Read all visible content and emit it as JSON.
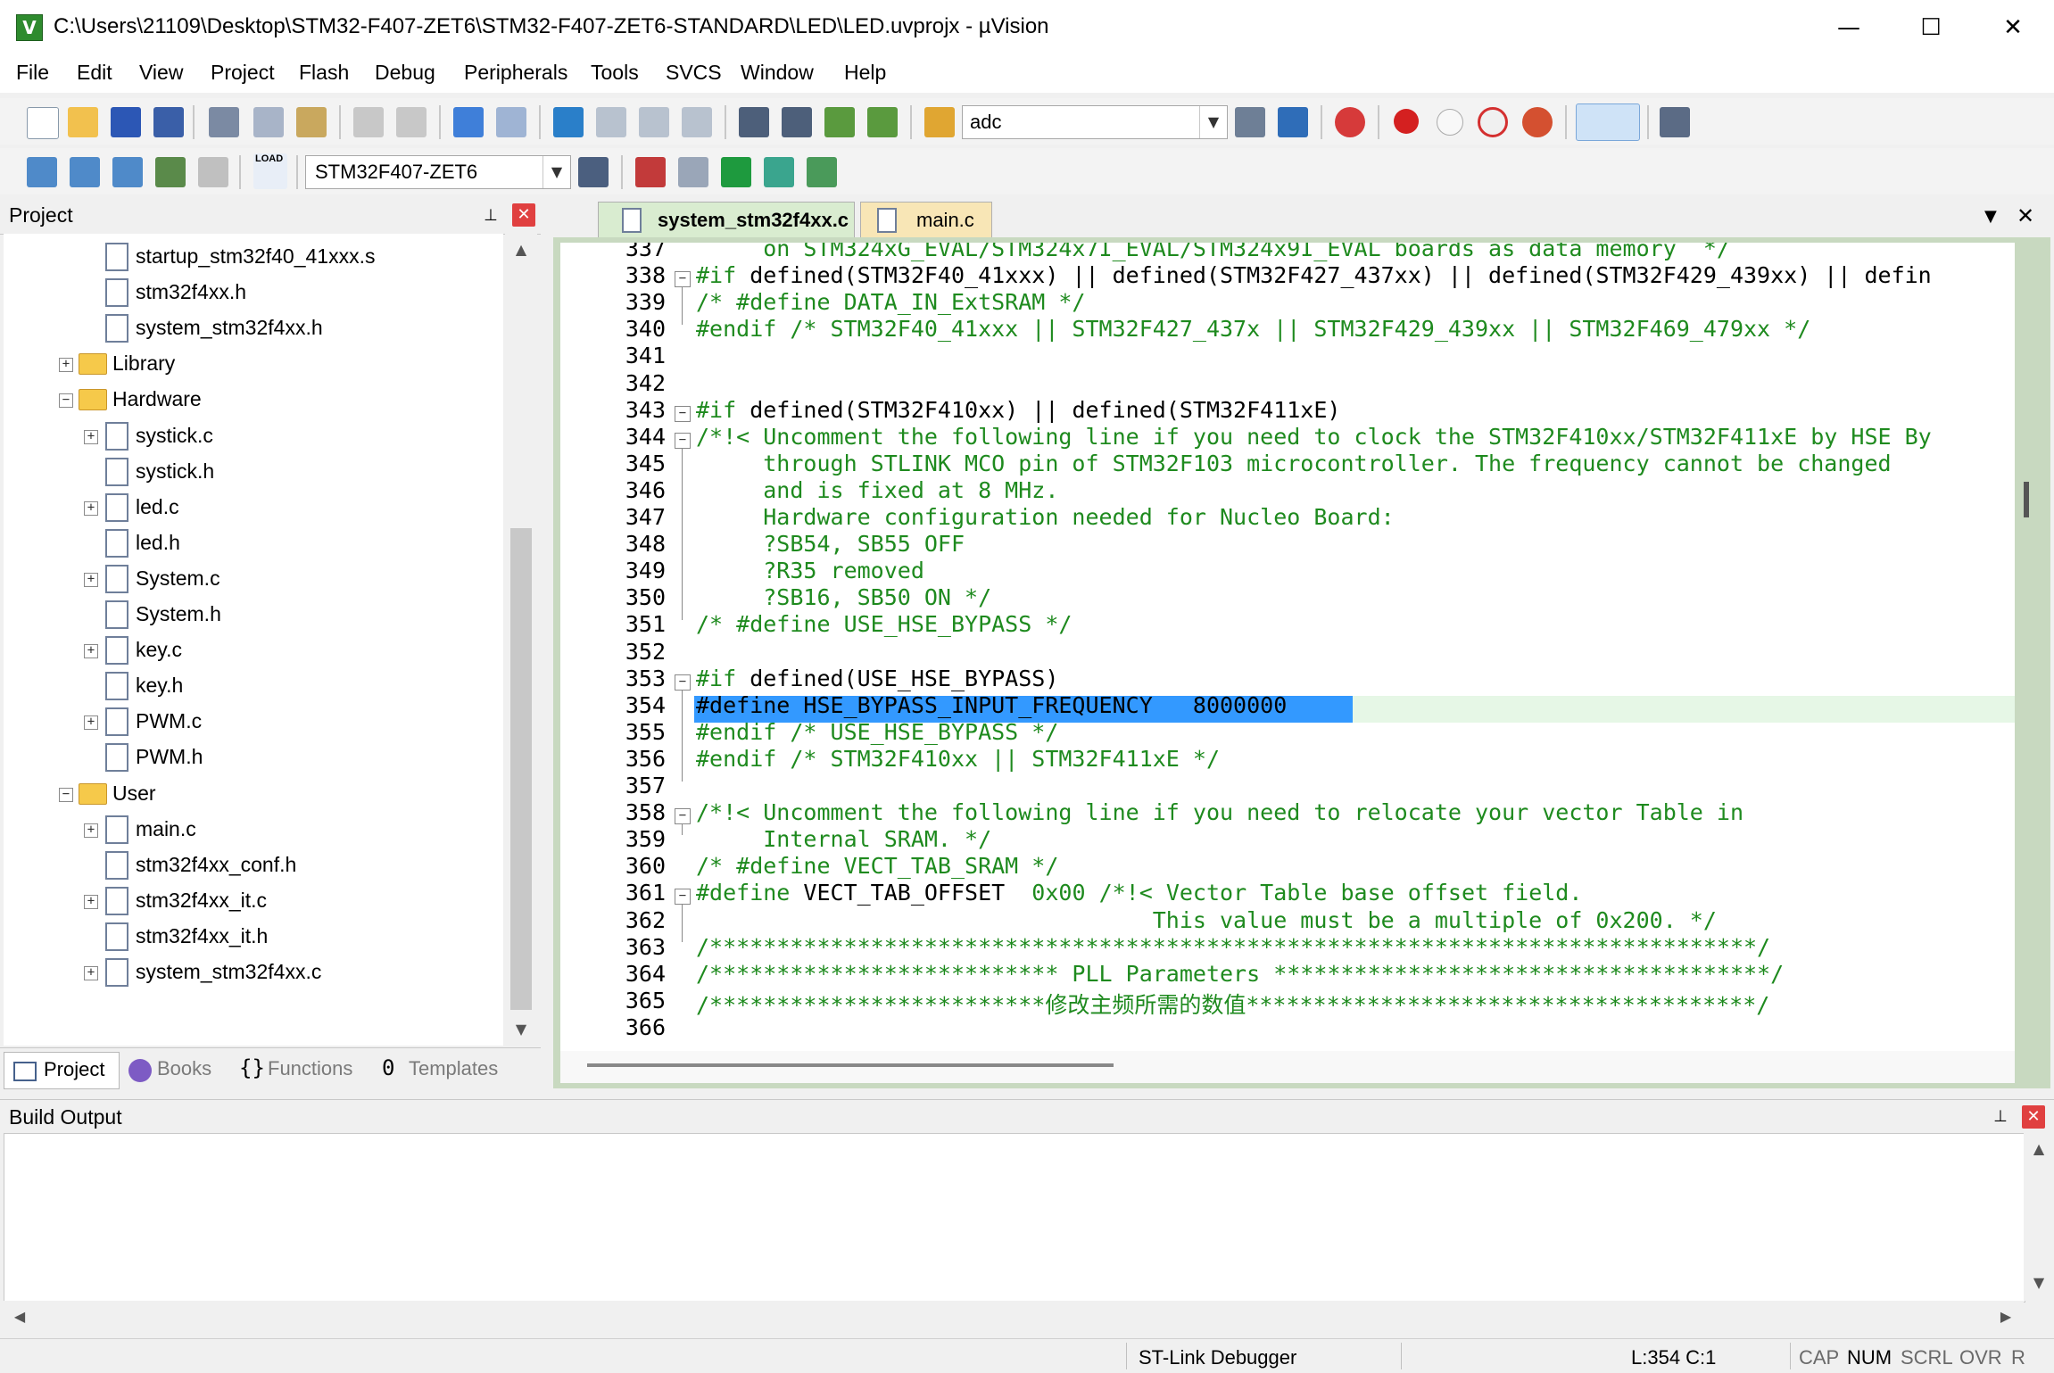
{
  "window": {
    "title": "C:\\Users\\21109\\Desktop\\STM32-F407-ZET6\\STM32-F407-ZET6-STANDARD\\LED\\LED.uvprojx - µVision",
    "app_icon": "V",
    "minimize": "—",
    "maximize": "☐",
    "close": "✕"
  },
  "menu": [
    "File",
    "Edit",
    "View",
    "Project",
    "Flash",
    "Debug",
    "Peripherals",
    "Tools",
    "SVCS",
    "Window",
    "Help"
  ],
  "toolbar": {
    "find_value": "adc",
    "target_value": "STM32F407-ZET6",
    "load_label": "LOAD"
  },
  "project_panel": {
    "title": "Project",
    "tree": [
      {
        "label": "startup_stm32f40_41xxx.s",
        "type": "file",
        "level": 2,
        "expander": ""
      },
      {
        "label": "stm32f4xx.h",
        "type": "file",
        "level": 2,
        "expander": ""
      },
      {
        "label": "system_stm32f4xx.h",
        "type": "file",
        "level": 2,
        "expander": ""
      },
      {
        "label": "Library",
        "type": "folder",
        "level": 1,
        "expander": "+"
      },
      {
        "label": "Hardware",
        "type": "folder",
        "level": 1,
        "expander": "−"
      },
      {
        "label": "systick.c",
        "type": "file",
        "level": 2,
        "expander": "+"
      },
      {
        "label": "systick.h",
        "type": "file",
        "level": 2,
        "expander": ""
      },
      {
        "label": "led.c",
        "type": "file",
        "level": 2,
        "expander": "+"
      },
      {
        "label": "led.h",
        "type": "file",
        "level": 2,
        "expander": ""
      },
      {
        "label": "System.c",
        "type": "file",
        "level": 2,
        "expander": "+"
      },
      {
        "label": "System.h",
        "type": "file",
        "level": 2,
        "expander": ""
      },
      {
        "label": "key.c",
        "type": "file",
        "level": 2,
        "expander": "+"
      },
      {
        "label": "key.h",
        "type": "file",
        "level": 2,
        "expander": ""
      },
      {
        "label": "PWM.c",
        "type": "file",
        "level": 2,
        "expander": "+"
      },
      {
        "label": "PWM.h",
        "type": "file",
        "level": 2,
        "expander": ""
      },
      {
        "label": "User",
        "type": "folder",
        "level": 1,
        "expander": "−"
      },
      {
        "label": "main.c",
        "type": "file",
        "level": 2,
        "expander": "+"
      },
      {
        "label": "stm32f4xx_conf.h",
        "type": "file",
        "level": 2,
        "expander": ""
      },
      {
        "label": "stm32f4xx_it.c",
        "type": "file",
        "level": 2,
        "expander": "+"
      },
      {
        "label": "stm32f4xx_it.h",
        "type": "file",
        "level": 2,
        "expander": ""
      },
      {
        "label": "system_stm32f4xx.c",
        "type": "file",
        "level": 2,
        "expander": "+"
      }
    ],
    "tabs": [
      "Project",
      "Books",
      "Functions",
      "Templates"
    ]
  },
  "editor": {
    "tabs": [
      "system_stm32f4xx.c",
      "main.c"
    ],
    "active_tab": "system_stm32f4xx.c",
    "lines": [
      {
        "n": "337",
        "text": "     on STM324xG_EVAL/STM324x7I_EVAL/STM324x9I_EVAL boards as data memory  */",
        "style": "g",
        "fold": ""
      },
      {
        "n": "338",
        "text": "#if defined(STM32F40_41xxx) || defined(STM32F427_437xx) || defined(STM32F429_439xx) || defin",
        "style": "pp",
        "fold": "−"
      },
      {
        "n": "339",
        "text": "/* #define DATA_IN_ExtSRAM */",
        "style": "g",
        "fold": ""
      },
      {
        "n": "340",
        "text": "#endif /* STM32F40_41xxx || STM32F427_437x || STM32F429_439xx || STM32F469_479xx */",
        "style": "g",
        "fold": ""
      },
      {
        "n": "341",
        "text": "",
        "style": "g",
        "fold": ""
      },
      {
        "n": "342",
        "text": "",
        "style": "g",
        "fold": ""
      },
      {
        "n": "343",
        "text": "#if defined(STM32F410xx) || defined(STM32F411xE)",
        "style": "pp",
        "fold": "−"
      },
      {
        "n": "344",
        "text": "/*!< Uncomment the following line if you need to clock the STM32F410xx/STM32F411xE by HSE By",
        "style": "g",
        "fold": "−"
      },
      {
        "n": "345",
        "text": "     through STLINK MCO pin of STM32F103 microcontroller. The frequency cannot be changed",
        "style": "g",
        "fold": ""
      },
      {
        "n": "346",
        "text": "     and is fixed at 8 MHz.",
        "style": "g",
        "fold": ""
      },
      {
        "n": "347",
        "text": "     Hardware configuration needed for Nucleo Board:",
        "style": "g",
        "fold": ""
      },
      {
        "n": "348",
        "text": "     ?SB54, SB55 OFF",
        "style": "g",
        "fold": ""
      },
      {
        "n": "349",
        "text": "     ?R35 removed",
        "style": "g",
        "fold": ""
      },
      {
        "n": "350",
        "text": "     ?SB16, SB50 ON */",
        "style": "g",
        "fold": ""
      },
      {
        "n": "351",
        "text": "/* #define USE_HSE_BYPASS */",
        "style": "g",
        "fold": ""
      },
      {
        "n": "352",
        "text": "",
        "style": "g",
        "fold": ""
      },
      {
        "n": "353",
        "text": "#if defined(USE_HSE_BYPASS)",
        "style": "pp",
        "fold": "−"
      },
      {
        "n": "354",
        "text": "#define HSE_BYPASS_INPUT_FREQUENCY   8000000",
        "style": "sel",
        "fold": ""
      },
      {
        "n": "355",
        "text": "#endif /* USE_HSE_BYPASS */",
        "style": "g",
        "fold": ""
      },
      {
        "n": "356",
        "text": "#endif /* STM32F410xx || STM32F411xE */",
        "style": "g",
        "fold": ""
      },
      {
        "n": "357",
        "text": "",
        "style": "g",
        "fold": ""
      },
      {
        "n": "358",
        "text": "/*!< Uncomment the following line if you need to relocate your vector Table in",
        "style": "g",
        "fold": "−"
      },
      {
        "n": "359",
        "text": "     Internal SRAM. */",
        "style": "g",
        "fold": ""
      },
      {
        "n": "360",
        "text": "/* #define VECT_TAB_SRAM */",
        "style": "g",
        "fold": ""
      },
      {
        "n": "361",
        "text": "#define VECT_TAB_OFFSET  0x00 /*!< Vector Table base offset field.",
        "style": "def",
        "fold": "−"
      },
      {
        "n": "362",
        "text": "                                  This value must be a multiple of 0x200. */",
        "style": "g",
        "fold": ""
      },
      {
        "n": "363",
        "text": "/******************************************************************************/",
        "style": "g",
        "fold": ""
      },
      {
        "n": "364",
        "text": "/************************** PLL Parameters *************************************/",
        "style": "g",
        "fold": ""
      },
      {
        "n": "365",
        "text": "/*************************修改主频所需的数值**************************************/",
        "style": "g",
        "fold": ""
      },
      {
        "n": "366",
        "text": "",
        "style": "g",
        "fold": ""
      }
    ]
  },
  "build_output": {
    "title": "Build Output"
  },
  "statusbar": {
    "debugger": "ST-Link Debugger",
    "position": "L:354 C:1",
    "cap": "CAP",
    "num": "NUM",
    "scrl": "SCRL",
    "ovr": "OVR",
    "rw": "R"
  },
  "colors": {
    "comment": "#1e8a1e",
    "selection": "#3399ff",
    "current_line": "#e6f7e6",
    "close_red": "#e04040"
  }
}
